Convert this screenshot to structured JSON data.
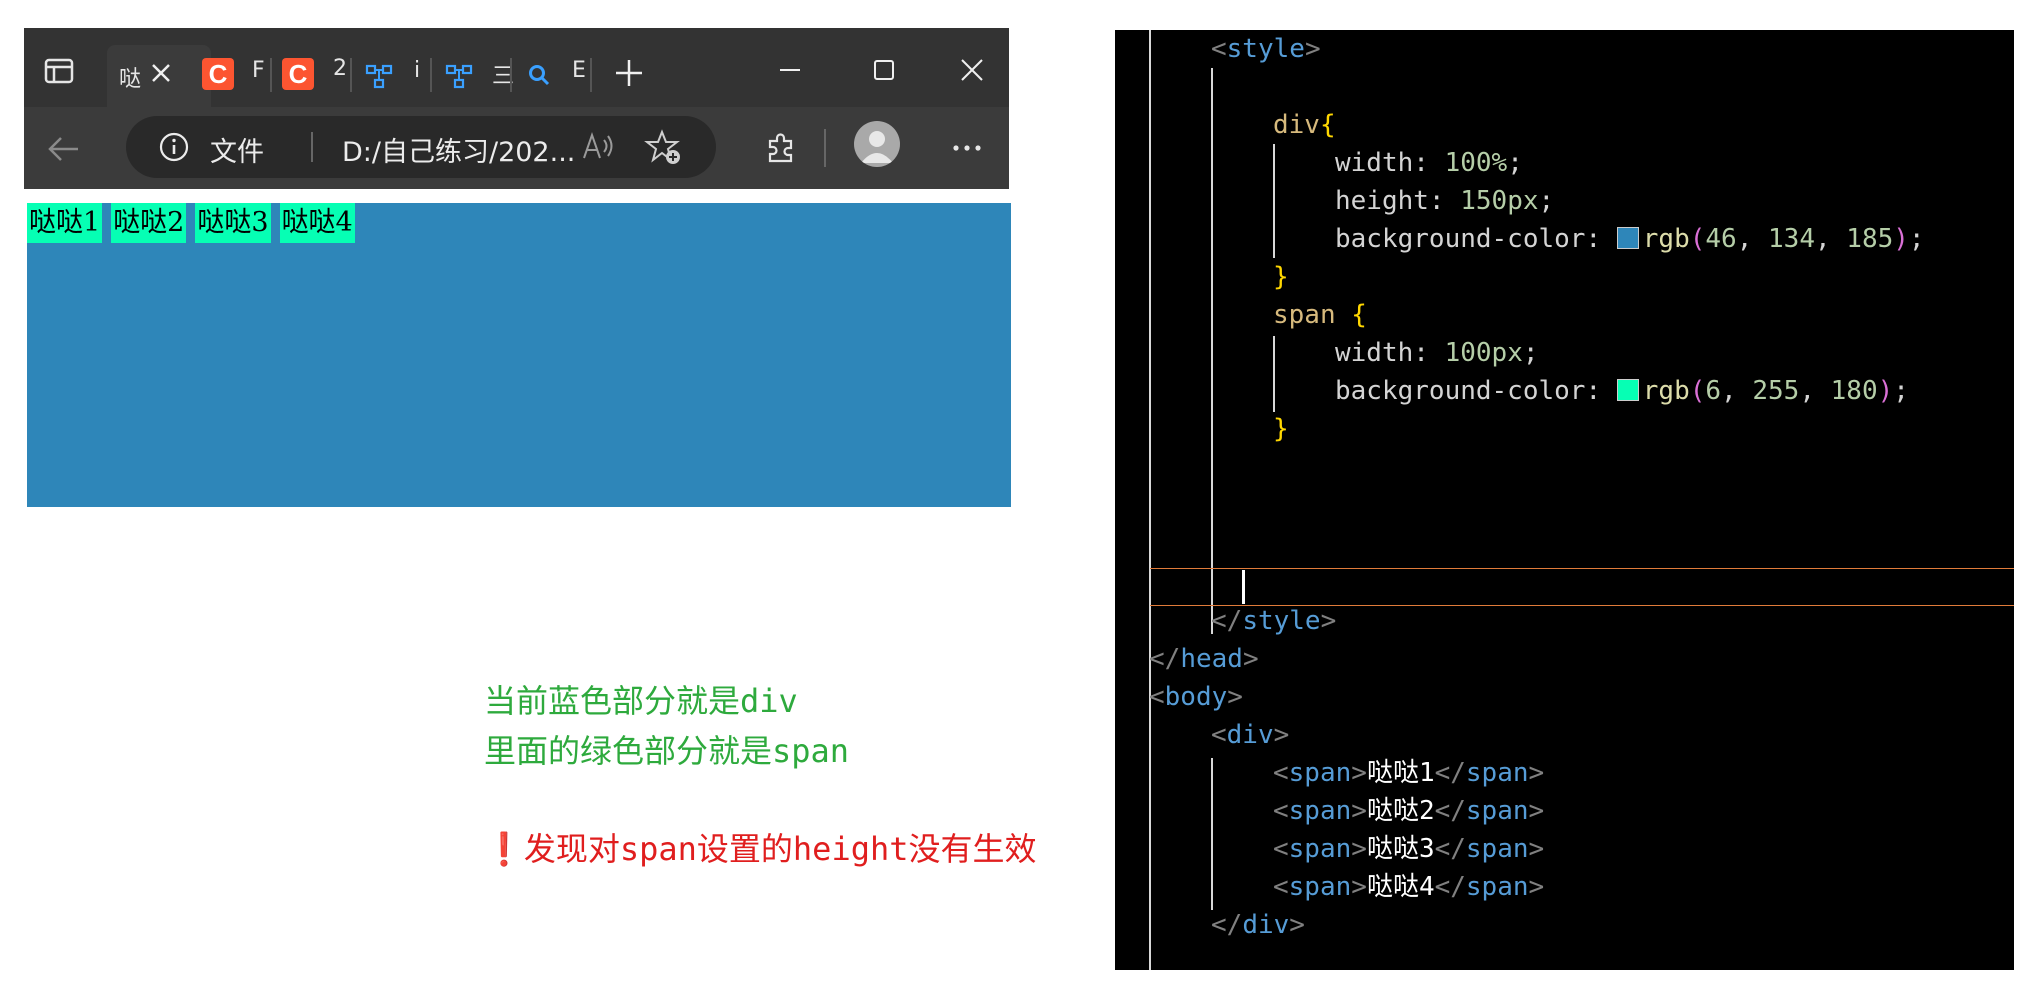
{
  "browser": {
    "address_info_label": "文件",
    "address_url": "D:/自己练习/202...",
    "tab_title_glyph": "哒",
    "mini_tab_glyphs": [
      "F",
      "2",
      "i",
      "三",
      "E"
    ],
    "csdn_letter": "C"
  },
  "page": {
    "spans": [
      "哒哒1",
      "哒哒2",
      "哒哒3",
      "哒哒4"
    ],
    "div_color": "#2e86b9",
    "span_color": "#06ffb4"
  },
  "annotation": {
    "line1": "当前蓝色部分就是div",
    "line2": "里面的绿色部分就是span",
    "warning_mark": "❗",
    "line3": "发现对span设置的height没有生效"
  },
  "code": {
    "style_open": "style",
    "div_selector": "div",
    "width_prop": "width",
    "width_val": "100%",
    "height_prop": "height",
    "height_val": "150px",
    "bg_prop": "background-color",
    "rgb_fn": "rgb",
    "div_rgb": [
      "46",
      "134",
      "185"
    ],
    "span_selector": "span",
    "span_width_val": "100px",
    "span_rgb": [
      "6",
      "255",
      "180"
    ],
    "style_close": "style",
    "head_close": "head",
    "body_open": "body",
    "div_open": "div",
    "span_tag": "span",
    "span_texts": [
      "哒哒1",
      "哒哒2",
      "哒哒3",
      "哒哒4"
    ],
    "div_close": "div"
  }
}
